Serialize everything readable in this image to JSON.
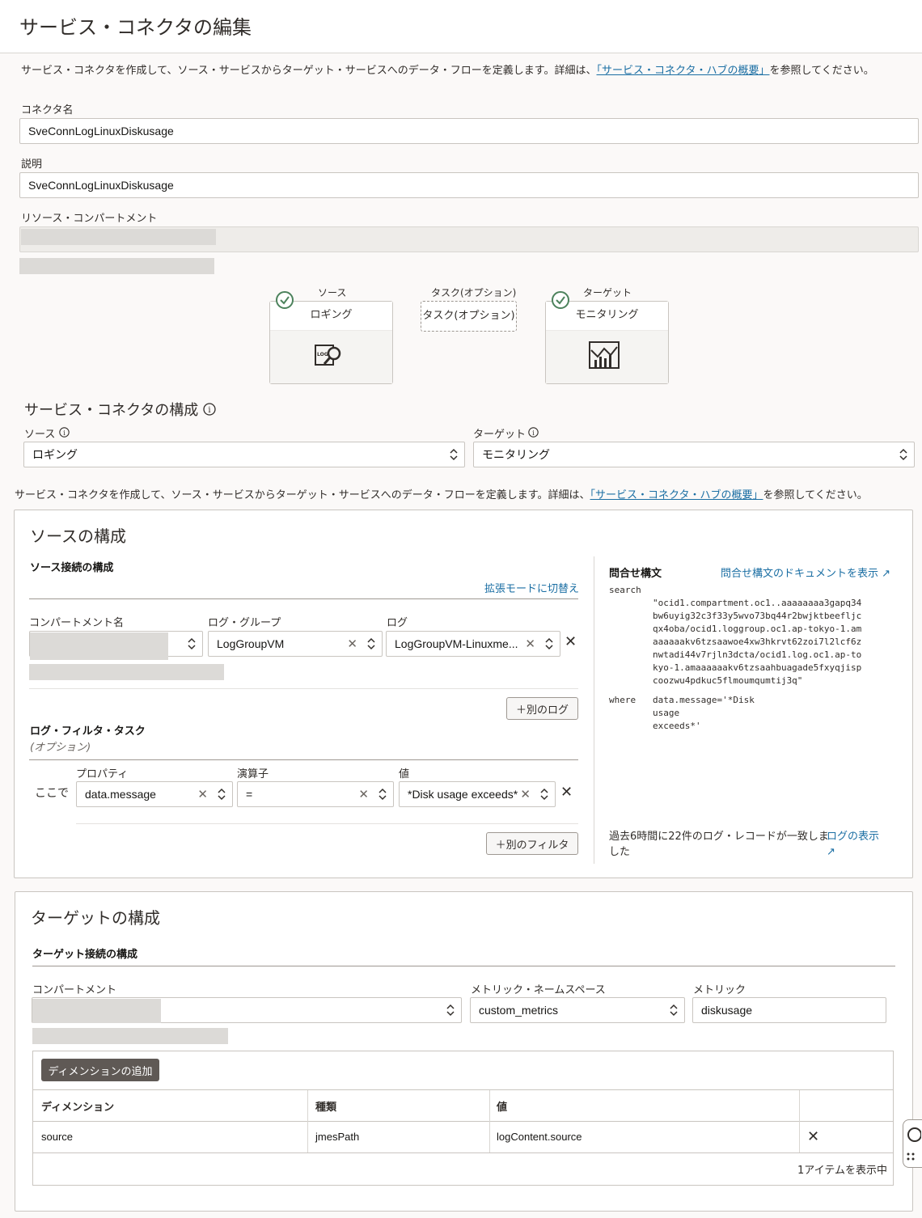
{
  "page": {
    "title": "サービス・コネクタの編集",
    "intro_text": "サービス・コネクタを作成して、ソース・サービスからターゲット・サービスへのデータ・フローを定義します。詳細は、",
    "intro_link": "「サービス・コネクタ・ハブの概要」",
    "intro_suffix": "を参照してください。"
  },
  "form": {
    "name_label": "コネクタ名",
    "name_value": "SveConnLogLinuxDiskusage",
    "desc_label": "説明",
    "desc_value": "SveConnLogLinuxDiskusage",
    "compartment_label": "リソース・コンパートメント"
  },
  "flow": {
    "source_header": "ソース",
    "source_name": "ロギング",
    "source_icon": "logs-search-icon",
    "task_header": "タスク(オプション)",
    "task_button": "タスク(オプション)",
    "target_header": "ターゲット",
    "target_name": "モニタリング",
    "target_icon": "monitoring-chart-icon"
  },
  "config": {
    "title": "サービス・コネクタの構成",
    "source_label": "ソース",
    "source_value": "ロギング",
    "target_label": "ターゲット",
    "target_value": "モニタリング"
  },
  "source_config": {
    "title": "ソースの構成",
    "connection_title": "ソース接続の構成",
    "advanced_mode": "拡張モードに切替え",
    "compartment_label": "コンパートメント名",
    "log_group_label": "ログ・グループ",
    "log_group_value": "LogGroupVM",
    "log_label": "ログ",
    "log_value": "LogGroupVM-Linuxme...",
    "add_log_button": "＋別のログ",
    "filter_title": "ログ・フィルタ・タスク",
    "filter_optional": "(オプション)",
    "where_label": "ここで",
    "property_label": "プロパティ",
    "property_value": "data.message",
    "operator_label": "演算子",
    "operator_value": "=",
    "value_label": "値",
    "value_value": "*Disk usage exceeds*",
    "add_filter_button": "＋別のフィルタ",
    "query_title": "問合せ構文",
    "query_doc_link": "問合せ構文のドキュメントを表示",
    "query_search_kw": "search",
    "query_search_lines": [
      "\"ocid1.compartment.oc1..aaaaaaaa3gapq34",
      "bw6uyig32c3f33y5wvo73bq44r2bwjktbeefljc",
      "qx4oba/ocid1.loggroup.oc1.ap-tokyo-1.am",
      "aaaaaakv6tzsaawoe4xw3hkrvt62zoi7l2lcf6z",
      "nwtadi44v7rjln3dcta/ocid1.log.oc1.ap-to",
      "kyo-1.amaaaaaakv6tzsaahbuagade5fxyqjisp",
      "coozwu4pdkuc5flmoumqumtij3q\""
    ],
    "query_where_kw": "where",
    "query_where_lines": [
      "data.message='*Disk",
      "usage",
      "exceeds*'"
    ],
    "match_text_1": "過去6時間に22件のログ・レコードが一致しま",
    "match_text_2": "した",
    "view_logs_link": "ログの表示"
  },
  "target_config": {
    "title": "ターゲットの構成",
    "connection_title": "ターゲット接続の構成",
    "compartment_label": "コンパートメント",
    "namespace_label": "メトリック・ネームスペース",
    "namespace_value": "custom_metrics",
    "metric_label": "メトリック",
    "metric_value": "diskusage",
    "add_dimension_button": "ディメンションの追加",
    "table_headers": [
      "ディメンション",
      "種類",
      "値"
    ],
    "rows": [
      {
        "dimension": "source",
        "type": "jmesPath",
        "value": "logContent.source"
      }
    ],
    "footer": "1アイテムを表示中"
  },
  "colors": {
    "link": "#1a6ea3",
    "success": "#4c825c",
    "dark_button": "#5f5955"
  }
}
